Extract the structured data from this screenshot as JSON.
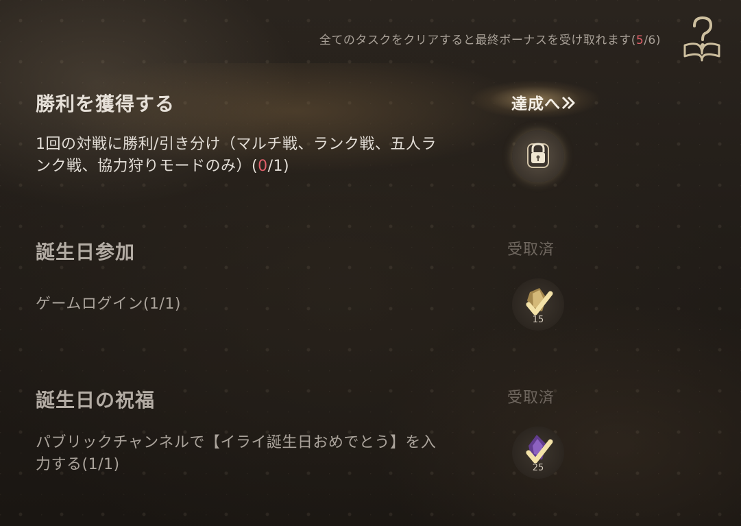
{
  "header": {
    "note_prefix": "全てのタスクをクリアすると最終ボーナスを受け取れます(",
    "note_progress": "5",
    "note_suffix": "/6)",
    "help_icon": "book-question-icon"
  },
  "tasks": [
    {
      "title": "勝利を獲得する",
      "desc_text": "1回の対戦に勝利/引き分け（マルチ戦、ランク戦、五人ランク戦、協力狩りモードのみ）(",
      "desc_progress": "0",
      "desc_suffix": "/1)",
      "action_label": "達成へ",
      "action_icon": "double-chevron-right-icon",
      "reward_icon": "lock-icon"
    },
    {
      "title": "誕生日参加",
      "desc_text": "ゲームログイン(1/1)",
      "status_label": "受取済",
      "reward_icon": "gold-crystal-icon",
      "reward_count": "15"
    },
    {
      "title": "誕生日の祝福",
      "desc_text": "パブリックチャンネルで【イライ誕生日おめでとう】を入力する(1/1)",
      "status_label": "受取済",
      "reward_icon": "purple-crystal-icon",
      "reward_count": "25"
    }
  ],
  "colors": {
    "highlight": "#e0606a",
    "text": "#e2ddd6",
    "muted": "#6f675f"
  }
}
